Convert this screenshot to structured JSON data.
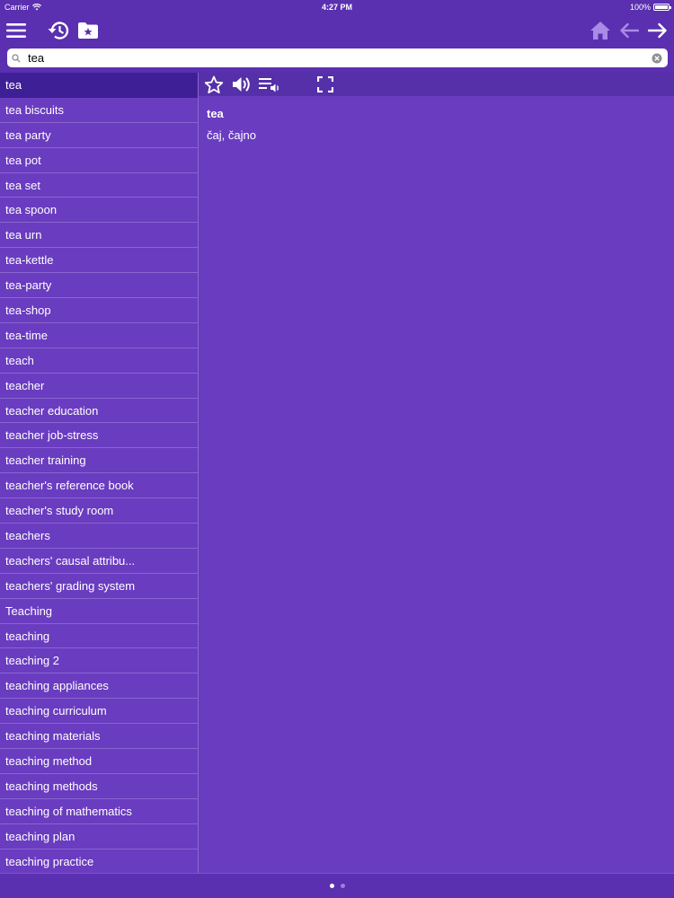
{
  "status": {
    "carrier": "Carrier",
    "time": "4:27 PM",
    "battery": "100%"
  },
  "nav": {
    "icons": [
      "menu-icon",
      "history-icon",
      "favorites-folder-icon",
      "home-icon",
      "back-arrow-icon",
      "forward-arrow-icon"
    ]
  },
  "search": {
    "value": "tea",
    "placeholder": ""
  },
  "word_list": [
    "tea",
    "tea biscuits",
    "tea party",
    "tea pot",
    "tea set",
    "tea spoon",
    "tea urn",
    "tea-kettle",
    "tea-party",
    "tea-shop",
    "tea-time",
    "teach",
    "teacher",
    "teacher education",
    "teacher job-stress",
    "teacher training",
    "teacher's reference book",
    "teacher's study room",
    "teachers",
    "teachers' causal attribu...",
    "teachers' grading system",
    "Teaching",
    "teaching",
    "teaching 2",
    "teaching appliances",
    "teaching curriculum",
    "teaching materials",
    "teaching method",
    "teaching methods",
    "teaching of mathematics",
    "teaching plan",
    "teaching practice"
  ],
  "selected_index": 0,
  "detail": {
    "headword": "tea",
    "translation": "čaj, čajno"
  },
  "colors": {
    "background": "#5a2fb0",
    "list_background": "#6a3cc0",
    "selected_row": "#3f1f95",
    "icon_accent": "#a98be6"
  },
  "pager": {
    "pages": 2,
    "current": 1
  }
}
